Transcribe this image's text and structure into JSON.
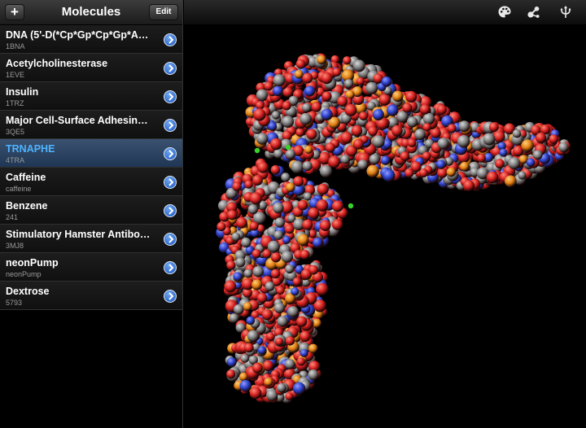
{
  "sidebar": {
    "title": "Molecules",
    "add_label": "+",
    "edit_label": "Edit",
    "items": [
      {
        "name": "DNA (5'-D(*Cp*Gp*Cp*Gp*Ap…",
        "code": "1BNA",
        "selected": false
      },
      {
        "name": "Acetylcholinesterase",
        "code": "1EVE",
        "selected": false
      },
      {
        "name": "Insulin",
        "code": "1TRZ",
        "selected": false
      },
      {
        "name": "Major Cell-Surface Adhesin…",
        "code": "3QE5",
        "selected": false
      },
      {
        "name": "TRNAPHE",
        "code": "4TRA",
        "selected": true
      },
      {
        "name": "Caffeine",
        "code": "caffeine",
        "selected": false
      },
      {
        "name": "Benzene",
        "code": "241",
        "selected": false
      },
      {
        "name": "Stimulatory Hamster Antibod…",
        "code": "3MJ8",
        "selected": false
      },
      {
        "name": "neonPump",
        "code": "neonPump",
        "selected": false
      },
      {
        "name": "Dextrose",
        "code": "5793",
        "selected": false
      }
    ]
  },
  "toolbar": {
    "icons": [
      "palette-icon",
      "molecule-icon",
      "rotate-icon"
    ]
  },
  "colors": {
    "accent": "#4eb4ff",
    "oxygen": "#d21e1e",
    "carbon": "#7b7b7b",
    "nitrogen": "#2a3ec8",
    "phosphorus": "#e07d12",
    "magnesium": "#3bd12b"
  }
}
